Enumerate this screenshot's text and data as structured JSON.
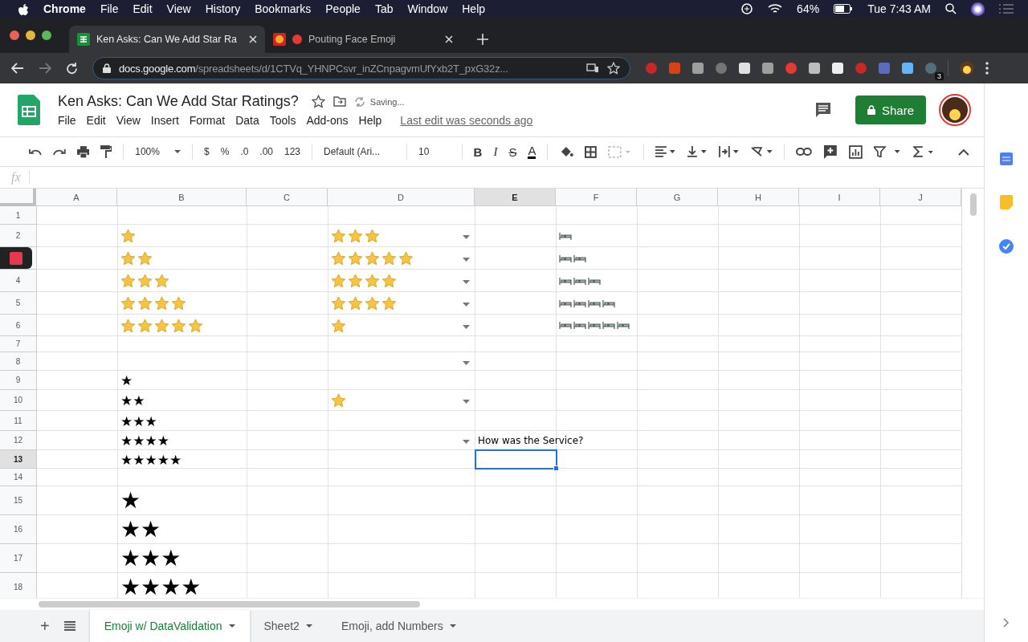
{
  "menu_bar": {
    "app": "Chrome",
    "items": [
      "File",
      "Edit",
      "View",
      "History",
      "Bookmarks",
      "People",
      "Tab",
      "Window",
      "Help"
    ],
    "battery": "64%",
    "clock": "Tue 7:43 AM"
  },
  "browser_tabs": [
    {
      "title": "Ken Asks: Can We Add Star Ra",
      "selected": true
    },
    {
      "title": "Pouting Face Emoji",
      "selected": false
    }
  ],
  "address_bar": {
    "host": "docs.google.com",
    "path": "/spreadsheets/d/1CTVq_YHNPCsvr_inZCnpagvmUfYxb2T_pxG32z..."
  },
  "extension_badge": "3",
  "document": {
    "title": "Ken Asks: Can We Add Star Ratings?",
    "status": "Saving...",
    "menus": [
      "File",
      "Edit",
      "View",
      "Insert",
      "Format",
      "Data",
      "Tools",
      "Add-ons",
      "Help"
    ],
    "last_edit": "Last edit was seconds ago",
    "share": "Share"
  },
  "toolbar": {
    "zoom": "100%",
    "currency": "$",
    "percent": "%",
    "decrease_decimals": ".0",
    "increase_decimals": ".00",
    "number_format": "123",
    "font": "Default (Ari...",
    "font_size": "10",
    "bold": "B",
    "italic": "I",
    "strikethrough": "S",
    "text_color": "A"
  },
  "formula_bar": {
    "label": "fx"
  },
  "columns": [
    {
      "label": "A",
      "selected": false
    },
    {
      "label": "B",
      "selected": false
    },
    {
      "label": "C",
      "selected": false
    },
    {
      "label": "D",
      "selected": false
    },
    {
      "label": "E",
      "selected": true
    },
    {
      "label": "F",
      "selected": false
    },
    {
      "label": "G",
      "selected": false
    },
    {
      "label": "H",
      "selected": false
    },
    {
      "label": "I",
      "selected": false
    },
    {
      "label": "J",
      "selected": false
    }
  ],
  "rows": [
    {
      "label": "1",
      "selected": false
    },
    {
      "label": "2",
      "selected": false,
      "b": {
        "kind": "emoji",
        "items": [
          {
            "kind": "star"
          }
        ]
      },
      "d": {
        "kind": "emoji",
        "items": [
          {
            "kind": "star"
          },
          {
            "kind": "star"
          },
          {
            "kind": "star"
          }
        ],
        "dropdown": true
      },
      "f": {
        "kind": "emoji",
        "items": [
          {
            "kind": "bed"
          }
        ]
      }
    },
    {
      "selected": false,
      "b": {
        "kind": "emoji",
        "items": [
          {
            "kind": "star"
          },
          {
            "kind": "star"
          }
        ]
      },
      "d": {
        "kind": "emoji",
        "items": [
          {
            "kind": "star"
          },
          {
            "kind": "star"
          },
          {
            "kind": "star"
          },
          {
            "kind": "star"
          },
          {
            "kind": "star"
          }
        ],
        "dropdown": true
      },
      "f": {
        "kind": "emoji",
        "items": [
          {
            "kind": "bed"
          },
          {
            "kind": "bed"
          }
        ]
      }
    },
    {
      "label": "4",
      "selected": false,
      "b": {
        "kind": "emoji",
        "items": [
          {
            "kind": "star"
          },
          {
            "kind": "star"
          },
          {
            "kind": "star"
          }
        ]
      },
      "d": {
        "kind": "emoji",
        "items": [
          {
            "kind": "star"
          },
          {
            "kind": "star"
          },
          {
            "kind": "star"
          },
          {
            "kind": "star"
          }
        ],
        "dropdown": true
      },
      "f": {
        "kind": "emoji",
        "items": [
          {
            "kind": "bed"
          },
          {
            "kind": "bed"
          },
          {
            "kind": "bed"
          }
        ]
      }
    },
    {
      "label": "5",
      "selected": false,
      "b": {
        "kind": "emoji",
        "items": [
          {
            "kind": "star"
          },
          {
            "kind": "star"
          },
          {
            "kind": "star"
          },
          {
            "kind": "star"
          }
        ]
      },
      "d": {
        "kind": "emoji",
        "items": [
          {
            "kind": "star"
          },
          {
            "kind": "star"
          },
          {
            "kind": "star"
          },
          {
            "kind": "star"
          }
        ],
        "dropdown": true
      },
      "f": {
        "kind": "emoji",
        "items": [
          {
            "kind": "bed"
          },
          {
            "kind": "bed"
          },
          {
            "kind": "bed"
          },
          {
            "kind": "bed"
          }
        ]
      }
    },
    {
      "label": "6",
      "selected": false,
      "b": {
        "kind": "emoji",
        "items": [
          {
            "kind": "star"
          },
          {
            "kind": "star"
          },
          {
            "kind": "star"
          },
          {
            "kind": "star"
          },
          {
            "kind": "star"
          }
        ]
      },
      "d": {
        "kind": "emoji",
        "items": [
          {
            "kind": "star"
          }
        ],
        "dropdown": true
      },
      "f": {
        "kind": "emoji",
        "items": [
          {
            "kind": "bed"
          },
          {
            "kind": "bed"
          },
          {
            "kind": "bed"
          },
          {
            "kind": "bed"
          },
          {
            "kind": "bed"
          }
        ]
      }
    },
    {
      "label": "7",
      "selected": false
    },
    {
      "label": "8",
      "selected": false,
      "d": {
        "kind": "empty",
        "dropdown": true
      }
    },
    {
      "label": "9",
      "selected": false,
      "b": {
        "kind": "text",
        "text": "★"
      }
    },
    {
      "label": "10",
      "selected": false,
      "b": {
        "kind": "text",
        "text": "★★"
      },
      "d": {
        "kind": "emoji",
        "items": [
          {
            "kind": "star"
          }
        ],
        "dropdown": true
      }
    },
    {
      "label": "11",
      "selected": false,
      "b": {
        "kind": "text",
        "text": "★★★"
      }
    },
    {
      "label": "12",
      "selected": false,
      "b": {
        "kind": "text",
        "text": "★★★★"
      },
      "d": {
        "kind": "empty",
        "dropdown": true
      },
      "e": {
        "kind": "text",
        "text": "How was the Service?"
      }
    },
    {
      "label": "13",
      "selected": true,
      "b": {
        "kind": "text",
        "text": "★★★★★"
      }
    },
    {
      "label": "14",
      "selected": false
    },
    {
      "label": "15",
      "selected": false,
      "b": {
        "kind": "large_text",
        "text": "★"
      }
    },
    {
      "label": "16",
      "selected": false,
      "b": {
        "kind": "large_text",
        "text": "★★"
      }
    },
    {
      "label": "17",
      "selected": false,
      "b": {
        "kind": "large_text",
        "text": "★★★"
      }
    },
    {
      "label": "18",
      "selected": false,
      "b": {
        "kind": "large_text",
        "text": "★★★★"
      }
    }
  ],
  "sheet_tabs": [
    {
      "label": "Emoji w/ DataValidation",
      "selected": true
    },
    {
      "label": "Sheet2",
      "selected": false
    },
    {
      "label": "Emoji, add Numbers",
      "selected": false
    }
  ],
  "sheet_buttons": {
    "add": "+"
  }
}
